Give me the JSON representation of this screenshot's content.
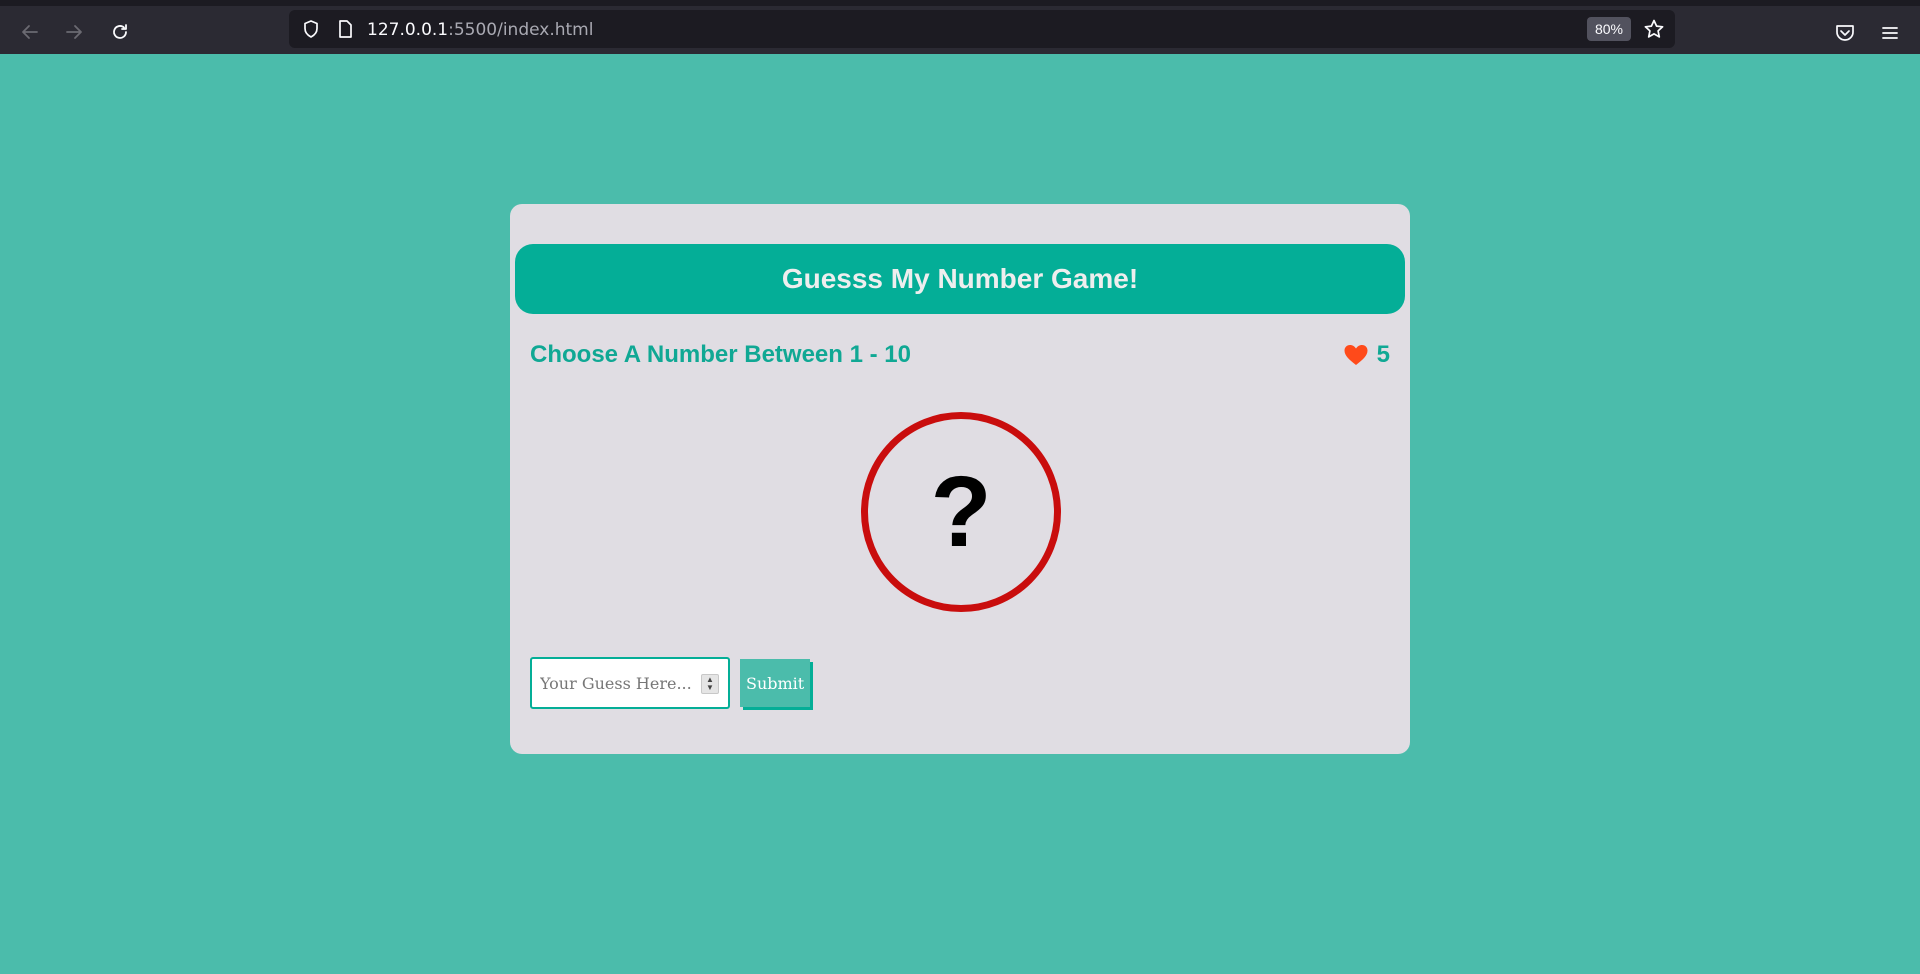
{
  "browser": {
    "url_host": "127.0.0.1",
    "url_path": ":5500/index.html",
    "zoom": "80%",
    "icons": {
      "back": "arrow-left-icon",
      "forward": "arrow-right-icon",
      "reload": "reload-icon",
      "shield": "shield-icon",
      "page": "page-icon",
      "bookmark": "star-icon",
      "pocket": "pocket-icon",
      "menu": "hamburger-menu-icon"
    }
  },
  "game": {
    "title": "Guesss My Number Game!",
    "subtitle": "Choose A Number Between 1 - 10",
    "lives": "5",
    "secret_display": "?",
    "input_placeholder": "Your Guess Here...",
    "submit_label": "Submit"
  },
  "colors": {
    "page_background": "#4bbcab",
    "card_background": "#e0dde3",
    "accent": "#04ae97",
    "circle_border": "#c90d0d",
    "heart": "#ff4a1a"
  }
}
